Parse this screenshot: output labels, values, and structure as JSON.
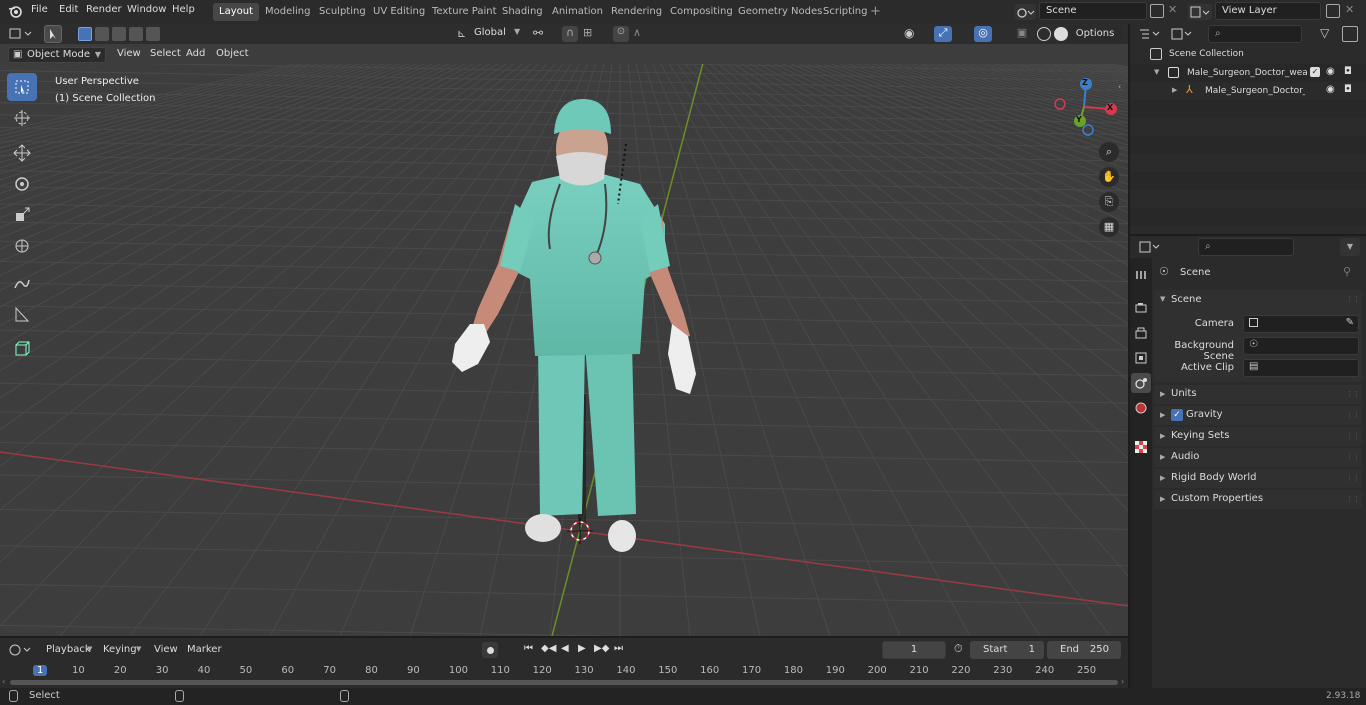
{
  "menu": [
    "File",
    "Edit",
    "Render",
    "Window",
    "Help"
  ],
  "workspaces": [
    "Layout",
    "Modeling",
    "Sculpting",
    "UV Editing",
    "Texture Paint",
    "Shading",
    "Animation",
    "Rendering",
    "Compositing",
    "Geometry Nodes",
    "Scripting"
  ],
  "scene_name": "Scene",
  "view_layer_name": "View Layer",
  "viewport": {
    "mode": "Object Mode",
    "menus": [
      "View",
      "Select",
      "Add",
      "Object"
    ],
    "orientation": "Global",
    "options_label": "Options",
    "info_line1": "User Perspective",
    "info_line2": "(1) Scene Collection",
    "gizmo_x": "X",
    "gizmo_y": "Y",
    "gizmo_z": "Z"
  },
  "outliner": {
    "root": "Scene Collection",
    "collection": "Male_Surgeon_Doctor_wearin",
    "object": "Male_Surgeon_Doctor_w"
  },
  "properties": {
    "header": "Scene",
    "section": "Scene",
    "camera_label": "Camera",
    "bg_scene_label": "Background Scene",
    "active_clip_label": "Active Clip",
    "panels": [
      "Units",
      "Gravity",
      "Keying Sets",
      "Audio",
      "Rigid Body World",
      "Custom Properties"
    ]
  },
  "timeline": {
    "menus": [
      "Playback",
      "Keying",
      "View",
      "Marker"
    ],
    "current_frame": "1",
    "start_label": "Start",
    "start_value": "1",
    "end_label": "End",
    "end_value": "250",
    "ruler": [
      "1",
      "10",
      "20",
      "30",
      "40",
      "50",
      "60",
      "70",
      "80",
      "90",
      "100",
      "110",
      "120",
      "130",
      "140",
      "150",
      "160",
      "170",
      "180",
      "190",
      "200",
      "210",
      "220",
      "230",
      "240",
      "250"
    ]
  },
  "status": {
    "select": "Select",
    "version": "2.93.18"
  }
}
